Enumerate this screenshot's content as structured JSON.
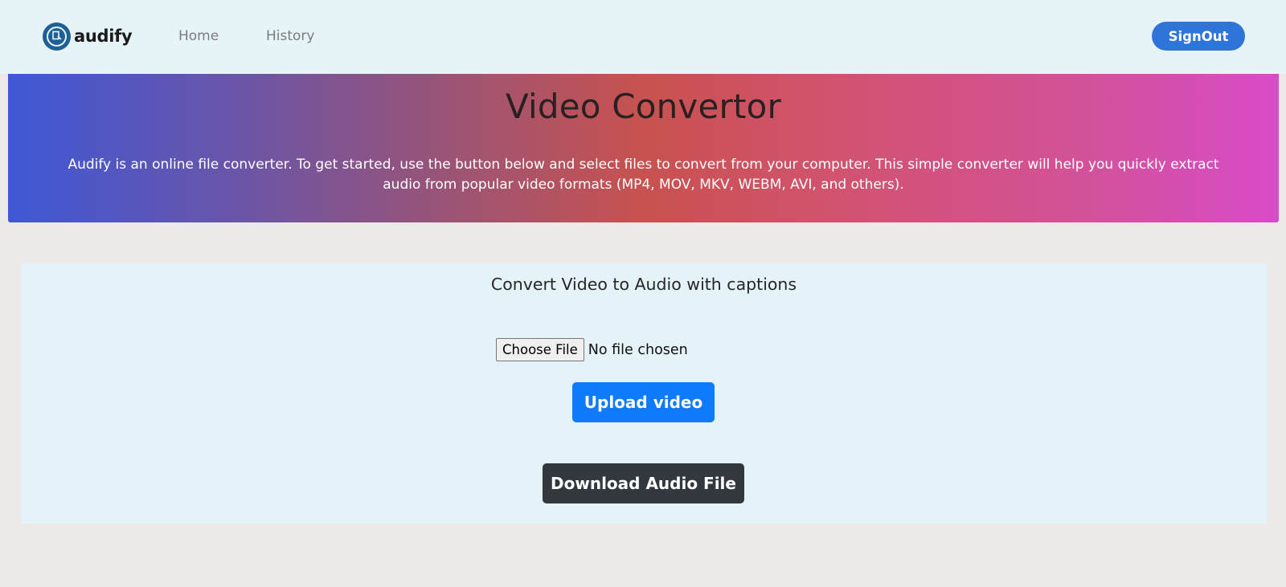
{
  "nav": {
    "brand_name": "audify",
    "brand_icon": "audify-logo-icon",
    "links": [
      "Home",
      "History"
    ],
    "signout_label": "SignOut"
  },
  "hero": {
    "title": "Video Convertor",
    "description": "Audify is an online file converter. To get started, use the button below and select files to convert from your computer. This simple converter will help you quickly extract audio from popular video formats (MP4, MOV, MKV, WEBM, AVI, and others)."
  },
  "converter": {
    "title": "Convert Video to Audio with captions",
    "choose_file_label": "Choose File",
    "file_status": "No file chosen",
    "upload_label": "Upload video",
    "download_label": "Download Audio File"
  },
  "colors": {
    "navbar_bg": "#e6f4f8",
    "page_bg": "#ede9e8",
    "signout_bg": "#2f74d8",
    "upload_bg": "#0d7bfb",
    "download_bg": "#32383e"
  }
}
